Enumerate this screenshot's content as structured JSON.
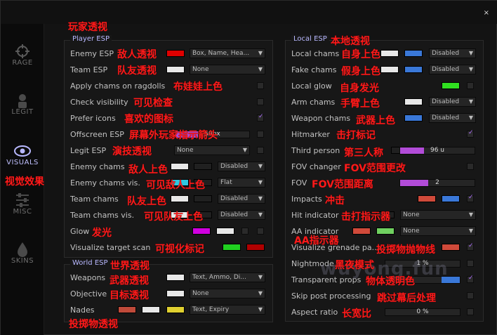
{
  "window": {
    "close": "×"
  },
  "sidebar": [
    {
      "label": "RAGE",
      "icon": "crosshair-icon"
    },
    {
      "label": "LEGIT",
      "icon": "soldier-icon"
    },
    {
      "label": "VISUALS",
      "icon": "eye-icon",
      "active": true
    },
    {
      "label": "MISC",
      "icon": "sliders-icon"
    },
    {
      "label": "SKINS",
      "icon": "droplet-icon"
    }
  ],
  "annotations": {
    "top": "玩家透视",
    "visuals": "视觉效果",
    "world": "世界透视",
    "local": "本地透视"
  },
  "player_esp": {
    "title": "Player ESP",
    "rows": [
      {
        "label": "Enemy ESP",
        "cn": "敌人透视",
        "dropdown": "Box, Name, Hea..."
      },
      {
        "label": "Team ESP",
        "cn": "队友透视",
        "dropdown": "None"
      },
      {
        "label": "Apply chams on ragdolls",
        "cn": "布娃娃上色"
      },
      {
        "label": "Check visibility",
        "cn": "可见检查"
      },
      {
        "label": "Prefer icons",
        "cn": "喜欢的图标"
      },
      {
        "label": "Offscreen ESP",
        "cn": "屏幕外玩家指示箭头",
        "slider": "50px"
      },
      {
        "label": "Legit ESP",
        "cn": "演技透视",
        "dropdown": "None"
      },
      {
        "label": "Enemy chams",
        "cn": "敌人上色",
        "dropdown": "Disabled"
      },
      {
        "label": "Enemy chams vis.",
        "cn": "可见敌人上色",
        "dropdown": "Flat"
      },
      {
        "label": "Team chams",
        "cn": "队友上色",
        "dropdown": "Disabled"
      },
      {
        "label": "Team chams vis.",
        "cn": "可见队友上色",
        "dropdown": "Disabled"
      },
      {
        "label": "Glow",
        "cn": "发光"
      },
      {
        "label": "Visualize target scan",
        "cn": "可视化标记"
      }
    ]
  },
  "world_esp": {
    "title": "World ESP",
    "rows": [
      {
        "label": "Weapons",
        "cn": "武器透视",
        "dropdown": "Text, Ammo, Di..."
      },
      {
        "label": "Objective",
        "cn": "目标透视",
        "dropdown": "None"
      },
      {
        "label": "Nades",
        "cn": "投掷物透视",
        "dropdown": "Text, Expiry"
      }
    ]
  },
  "local_esp": {
    "title": "Local ESP",
    "rows": [
      {
        "label": "Local chams",
        "cn": "自身上色",
        "dropdown": "Disabled"
      },
      {
        "label": "Fake chams",
        "cn": "假身上色",
        "dropdown": "Disabled"
      },
      {
        "label": "Local glow",
        "cn": "自身发光"
      },
      {
        "label": "Arm chams",
        "cn": "手臂上色",
        "dropdown": "Disabled"
      },
      {
        "label": "Weapon chams",
        "cn": "武器上色",
        "dropdown": "Disabled"
      },
      {
        "label": "Hitmarker",
        "cn": "击打标记"
      },
      {
        "label": "Third person",
        "cn": "第三人称",
        "slider": "96 u"
      },
      {
        "label": "FOV changer",
        "cn": "FOV范围更改"
      },
      {
        "label": "FOV",
        "cn": "FOV范围距离",
        "slider": "2"
      },
      {
        "label": "Impacts",
        "cn": "冲击"
      },
      {
        "label": "Hit indicator",
        "cn": "击打指示器",
        "dropdown": "None"
      },
      {
        "label": "AA indicator",
        "cn": "AA指示器",
        "dropdown": "None"
      },
      {
        "label": "Visualize grenade pa...",
        "cn": "投掷物抛物线"
      },
      {
        "label": "Nightmode",
        "cn": "黑夜模式",
        "slider": "1 %"
      },
      {
        "label": "Transparent props",
        "cn": "物体透明色"
      },
      {
        "label": "Skip post processing",
        "cn": "跳过幕后处理"
      },
      {
        "label": "Aspect ratio",
        "cn": "长宽比",
        "slider": "0 %"
      }
    ]
  },
  "watermark": "wuyong.fun",
  "colors": {
    "accent": "#b24cd8",
    "label_red": "#ff1a1a",
    "title_blue": "#b8b8ff"
  }
}
